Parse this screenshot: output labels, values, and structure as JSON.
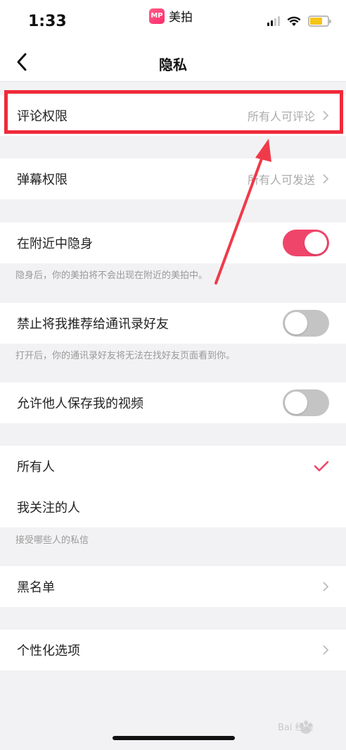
{
  "status": {
    "time": "1:33",
    "app_name": "美拍",
    "app_logo_text": "MP"
  },
  "nav": {
    "title": "隐私"
  },
  "rows": {
    "comment": {
      "label": "评论权限",
      "value": "所有人可评论"
    },
    "danmaku": {
      "label": "弹幕权限",
      "value": "所有人可发送"
    },
    "nearby": {
      "label": "在附近中隐身",
      "toggle": true,
      "hint": "隐身后，你的美拍将不会出现在附近的美拍中。"
    },
    "recommend": {
      "label": "禁止将我推荐给通讯录好友",
      "toggle": false,
      "hint": "打开后，你的通讯录好友将无法在找好友页面看到你。"
    },
    "save_video": {
      "label": "允许他人保存我的视频",
      "toggle": false
    }
  },
  "messages": {
    "options": [
      {
        "label": "所有人",
        "selected": true
      },
      {
        "label": "我关注的人",
        "selected": false
      }
    ],
    "hint": "接受哪些人的私信"
  },
  "blacklist": {
    "label": "黑名单"
  },
  "personalize": {
    "label": "个性化选项"
  },
  "watermark": {
    "text": "Bai 经验"
  },
  "colors": {
    "accent": "#f0456a",
    "highlight": "#f02a3a",
    "background": "#f2f2f4"
  },
  "icons": [
    "back-icon",
    "chevron-right-icon",
    "check-icon",
    "wifi-icon",
    "battery-icon",
    "signal-icon"
  ]
}
